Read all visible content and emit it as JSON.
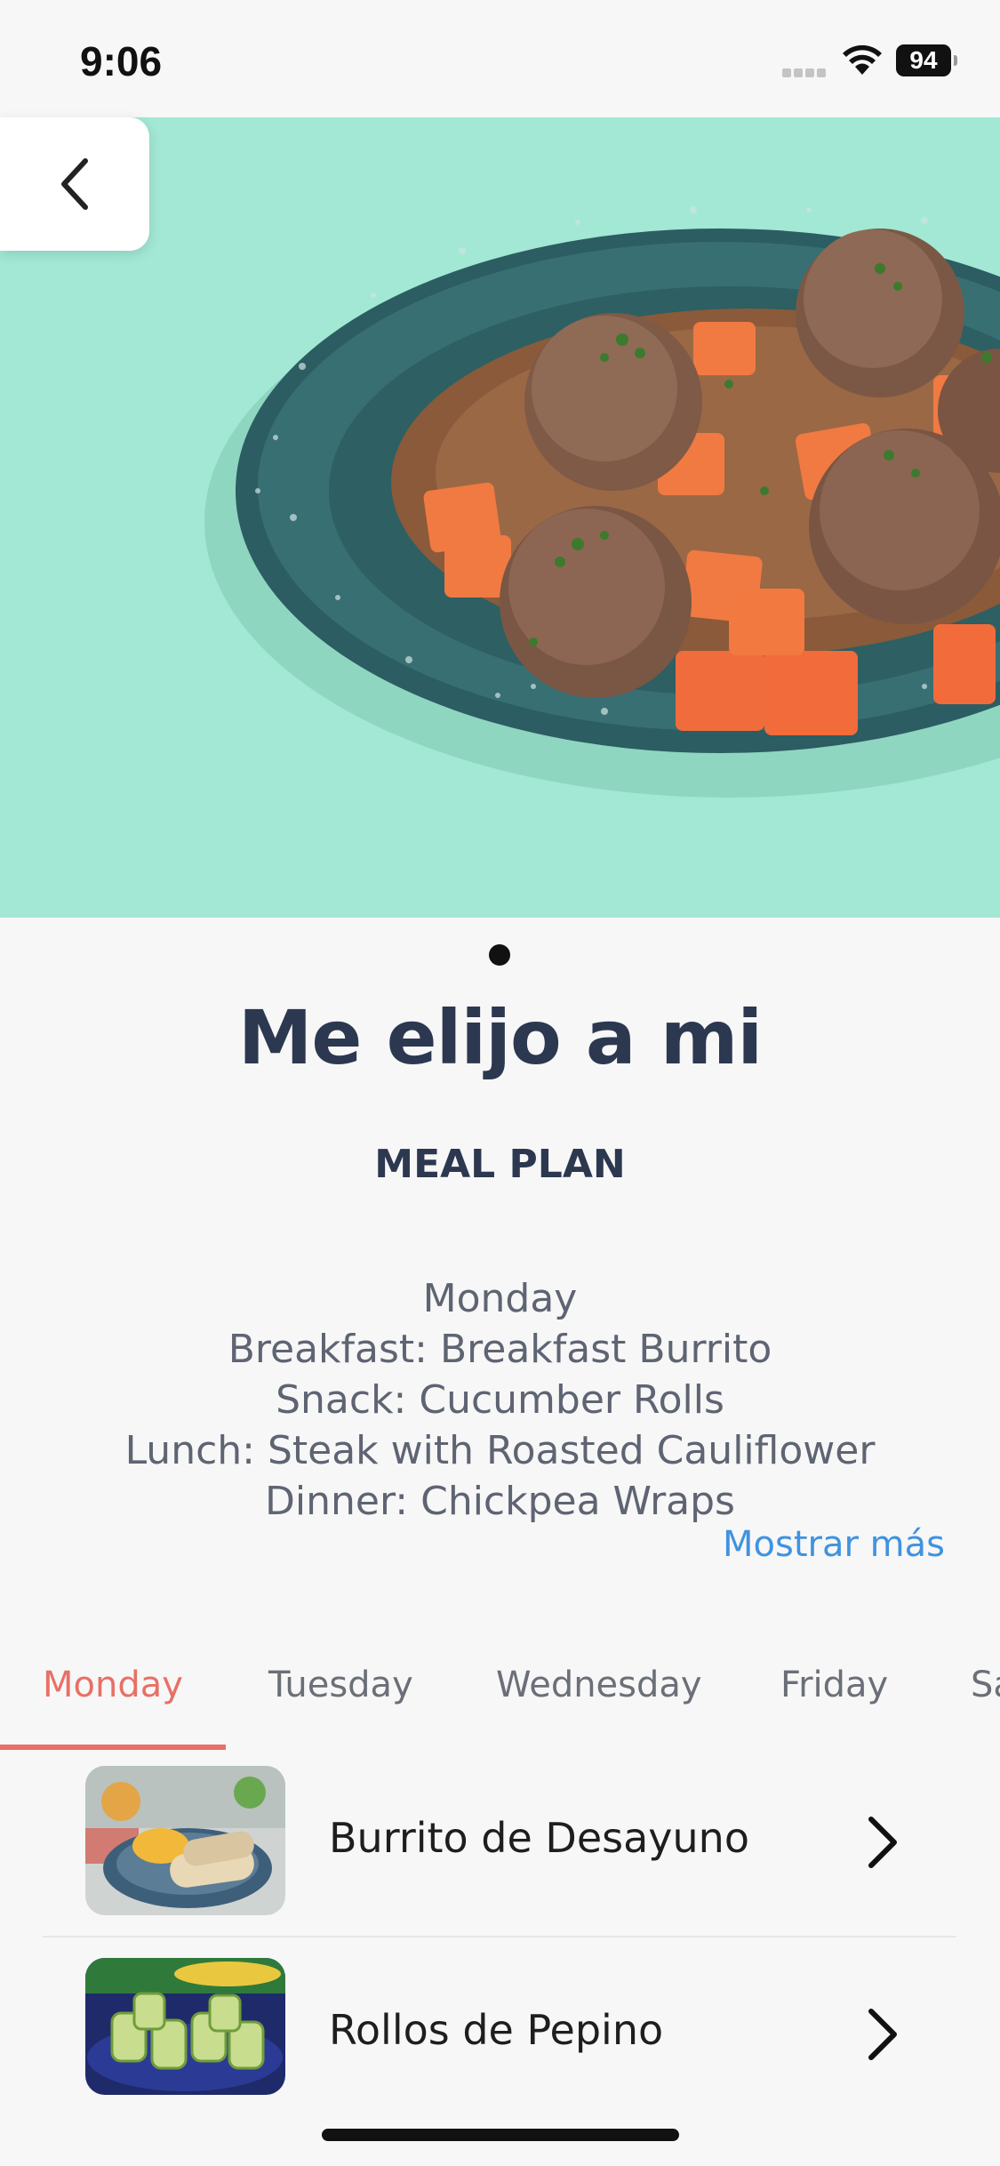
{
  "status_bar": {
    "time": "9:06",
    "battery": "94",
    "icons": [
      "signal-icon",
      "wifi-icon",
      "battery-icon"
    ]
  },
  "hero": {
    "image": "meatballs-plate-image",
    "background_color": "#a2e8d4",
    "back_icon": "chevron-left-icon",
    "carousel_dots": 1
  },
  "plan": {
    "title": "Me elijo a mi",
    "subtitle": "MEAL PLAN",
    "description_lines": [
      "Monday",
      "Breakfast: Breakfast Burrito",
      "Snack: Cucumber Rolls",
      "Lunch: Steak with Roasted Cauliflower",
      "Dinner: Chickpea Wraps"
    ],
    "show_more": "Mostrar más"
  },
  "tabs": [
    {
      "label": "Monday",
      "active": true
    },
    {
      "label": "Tuesday",
      "active": false
    },
    {
      "label": "Wednesday",
      "active": false
    },
    {
      "label": "Friday",
      "active": false
    },
    {
      "label": "Sa",
      "active": false
    }
  ],
  "meals": [
    {
      "name": "Burrito de Desayuno",
      "thumb": "burrito-thumbnail",
      "icon": "chevron-right-icon"
    },
    {
      "name": "Rollos de Pepino",
      "thumb": "cucumber-rolls-thumbnail",
      "icon": "chevron-right-icon"
    }
  ],
  "colors": {
    "accent": "#e87066",
    "link": "#3f93e0",
    "title": "#2c3850",
    "body_text": "#5e6472"
  }
}
